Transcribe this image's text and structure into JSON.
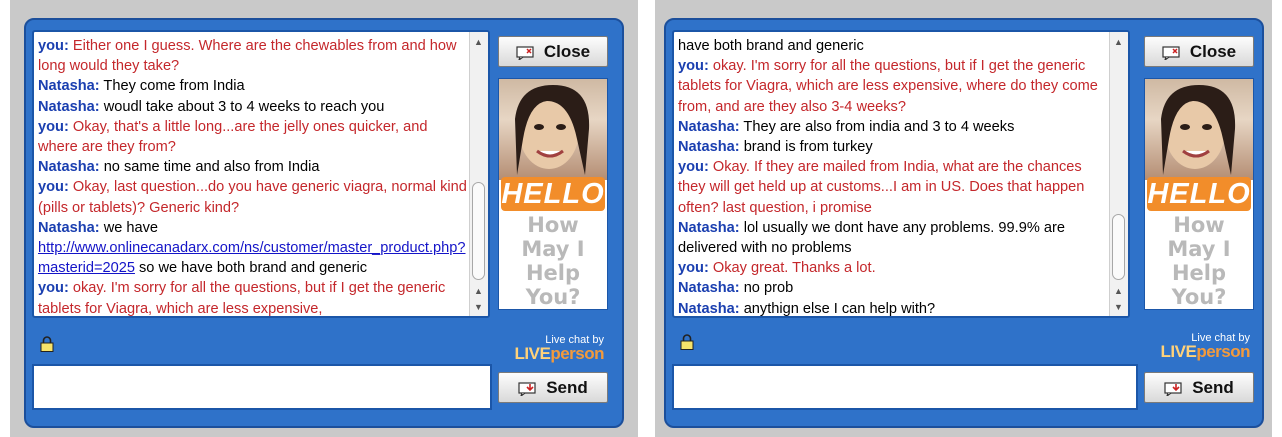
{
  "panels": [
    {
      "close_label": "Close",
      "send_label": "Send",
      "powered_by": "Live chat by",
      "brand_live": "LIVE",
      "brand_person": "person",
      "ad_hello": "HELLO",
      "ad_lines": [
        "How",
        "May I",
        "Help",
        "You?"
      ],
      "input_value": "",
      "messages": [
        {
          "who": "you",
          "sender": "you:",
          "text": " Either one I guess. Where are the chewables from and how long would they take?"
        },
        {
          "who": "natasha",
          "sender": "Natasha:",
          "text": " They come from India"
        },
        {
          "who": "natasha",
          "sender": "Natasha:",
          "text": " woudl take about 3 to 4 weeks to reach you"
        },
        {
          "who": "you",
          "sender": "you:",
          "text": " Okay, that's a little long...are the jelly ones quicker, and where are they from?"
        },
        {
          "who": "natasha",
          "sender": "Natasha:",
          "text": " no same time and also from India"
        },
        {
          "who": "you",
          "sender": "you:",
          "text": " Okay, last question...do you have generic viagra, normal kind (pills or tablets)? Generic kind?"
        },
        {
          "who": "natasha",
          "sender": "Natasha:",
          "text": " we have ",
          "link": "http://www.onlinecanadarx.com/ns/customer/master_product.php?masterid=2025",
          "after": " so we have both brand and generic"
        },
        {
          "who": "you",
          "sender": "you:",
          "text": " okay. I'm sorry for all the questions, but if I get the generic tablets for Viagra, which are less expensive,"
        }
      ]
    },
    {
      "close_label": "Close",
      "send_label": "Send",
      "powered_by": "Live chat by",
      "brand_live": "LIVE",
      "brand_person": "person",
      "ad_hello": "HELLO",
      "ad_lines": [
        "How",
        "May I",
        "Help",
        "You?"
      ],
      "input_value": "",
      "messages": [
        {
          "who": "plain",
          "sender": "",
          "text": "have both brand and generic"
        },
        {
          "who": "you",
          "sender": "you:",
          "text": " okay. I'm sorry for all the questions, but if I get the generic tablets for Viagra, which are less expensive, where do they come from, and are they also 3-4 weeks?"
        },
        {
          "who": "natasha",
          "sender": "Natasha:",
          "text": " They are also from india and 3 to 4 weeks"
        },
        {
          "who": "natasha",
          "sender": "Natasha:",
          "text": " brand is from turkey"
        },
        {
          "who": "you",
          "sender": "you:",
          "text": " Okay. If they are mailed from India, what are the chances they will get held up at customs...I am in US. Does that happen often? last question, i promise"
        },
        {
          "who": "natasha",
          "sender": "Natasha:",
          "text": " lol usually we dont have any problems. 99.9% are delivered with no problems"
        },
        {
          "who": "you",
          "sender": "you:",
          "text": " Okay great. Thanks a lot."
        },
        {
          "who": "natasha",
          "sender": "Natasha:",
          "text": " no prob"
        },
        {
          "who": "natasha",
          "sender": "Natasha:",
          "text": " anythign else I can help with?"
        }
      ]
    }
  ]
}
